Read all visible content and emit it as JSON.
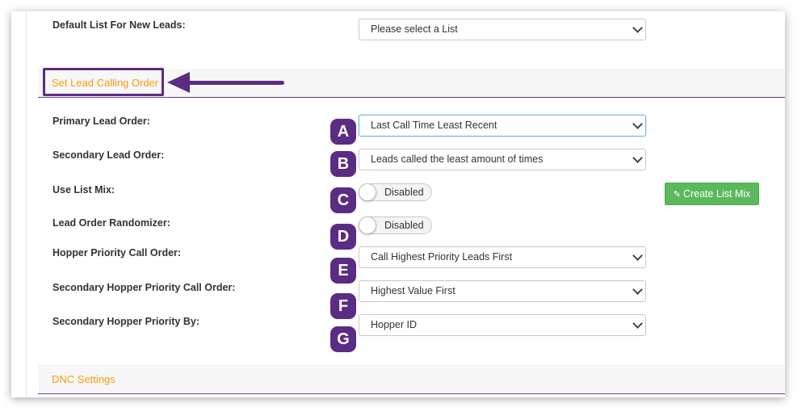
{
  "fields": {
    "default_list": {
      "label": "Default List For New Leads:",
      "value": "Please select a List"
    },
    "primary_lead_order": {
      "label": "Primary Lead Order:",
      "value": "Last Call Time Least Recent"
    },
    "secondary_lead_order": {
      "label": "Secondary Lead Order:",
      "value": "Leads called the least amount of times"
    },
    "use_list_mix": {
      "label": "Use List Mix:",
      "value": "Disabled"
    },
    "lead_order_randomizer": {
      "label": "Lead Order Randomizer:",
      "value": "Disabled"
    },
    "hopper_priority_call_order": {
      "label": "Hopper Priority Call Order:",
      "value": "Call Highest Priority Leads First"
    },
    "secondary_hopper_priority_call_order": {
      "label": "Secondary Hopper Priority Call Order:",
      "value": "Highest Value First"
    },
    "secondary_hopper_priority_by": {
      "label": "Secondary Hopper Priority By:",
      "value": "Hopper ID"
    }
  },
  "sections": {
    "lead_calling_order": "Set Lead Calling Order",
    "dnc_settings": "DNC Settings"
  },
  "buttons": {
    "create_list_mix": "Create List Mix",
    "create_list_mix_icon": "pencil-icon"
  },
  "annotations": {
    "badges": [
      "A",
      "B",
      "C",
      "D",
      "E",
      "F",
      "G"
    ],
    "accent_color": "#5b2c83"
  },
  "colors": {
    "section_title": "#f39c12",
    "button_green": "#5cb85c",
    "section_divider": "#6a3d8a"
  }
}
